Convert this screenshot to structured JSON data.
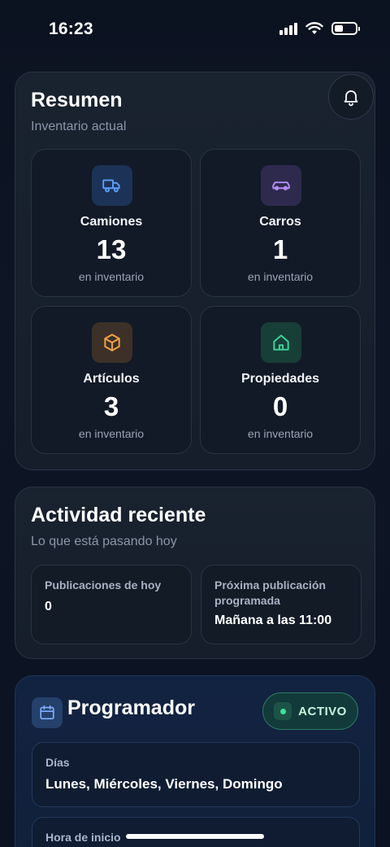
{
  "status_bar": {
    "time": "16:23"
  },
  "resumen": {
    "title": "Resumen",
    "subtitle": "Inventario actual",
    "tiles": [
      {
        "label": "Camiones",
        "count": "13",
        "sub": "en inventario",
        "icon": "truck-icon",
        "color": "#5b9cf5",
        "bg": "#1c3256"
      },
      {
        "label": "Carros",
        "count": "1",
        "sub": "en inventario",
        "icon": "car-icon",
        "color": "#b48cf5",
        "bg": "#2e2a4e"
      },
      {
        "label": "Artículos",
        "count": "3",
        "sub": "en inventario",
        "icon": "box-icon",
        "color": "#f0a34a",
        "bg": "#3d3028"
      },
      {
        "label": "Propiedades",
        "count": "0",
        "sub": "en inventario",
        "icon": "house-icon",
        "color": "#3fd39a",
        "bg": "#183e38"
      }
    ]
  },
  "actividad": {
    "title": "Actividad reciente",
    "subtitle": "Lo que está pasando hoy",
    "items": [
      {
        "label": "Publicaciones de hoy",
        "value": "0"
      },
      {
        "label": "Próxima publicación programada",
        "value": "Mañana a las 11:00"
      }
    ]
  },
  "programador": {
    "title": "Programador",
    "badge": "ACTIVO",
    "rows": [
      {
        "label": "Días",
        "value": "Lunes, Miércoles, Viernes, Domingo"
      },
      {
        "label": "Hora de inicio",
        "value": ""
      }
    ]
  },
  "colors": {
    "accent_green": "#3ee29a",
    "background": "#0b1220"
  }
}
